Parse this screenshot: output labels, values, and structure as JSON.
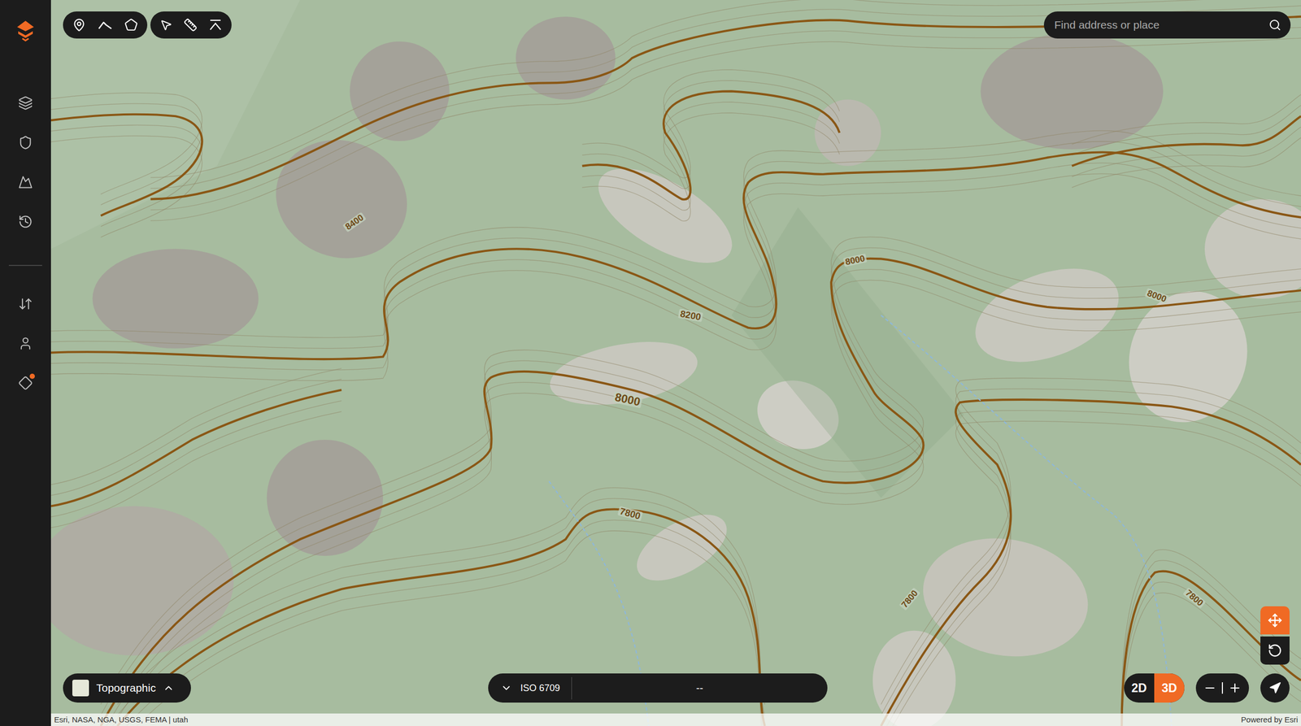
{
  "sidebar": {
    "items": [
      {
        "badge": false
      },
      {
        "badge": false
      },
      {
        "badge": false
      },
      {
        "badge": false
      },
      {
        "badge": false
      },
      {
        "badge": false
      },
      {
        "badge": true
      }
    ]
  },
  "search": {
    "placeholder": "Find address or place"
  },
  "contour_labels": [
    {
      "text": "8000"
    },
    {
      "text": "8200"
    },
    {
      "text": "7800"
    },
    {
      "text": "8000"
    },
    {
      "text": "8000"
    },
    {
      "text": "8400"
    },
    {
      "text": "7800"
    },
    {
      "text": "7800"
    }
  ],
  "basemap": {
    "label": "Topographic",
    "expanded": false
  },
  "coordinates": {
    "format": "ISO 6709",
    "value": "--"
  },
  "view_mode": [
    {
      "label": "2D",
      "selected": false
    },
    {
      "label": "3D",
      "selected": true
    }
  ],
  "navigation": [
    {
      "kind": "pan",
      "selected": true
    },
    {
      "kind": "rotate",
      "selected": false
    }
  ],
  "attribution": "Esri, NASA, NGA, USGS, FEMA | utah",
  "powered_by": "Powered by Esri"
}
